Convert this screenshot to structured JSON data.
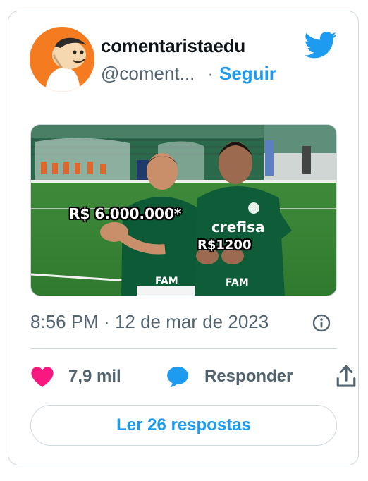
{
  "tweet": {
    "display_name": "comentaristaedu",
    "handle": "@coment...",
    "separator": "·",
    "follow_label": "Seguir",
    "timestamp": "8:56 PM · 12 de mar de 2023",
    "media": {
      "caption_top": "R$ 6.000.000*",
      "caption_bottom": "R$1200"
    },
    "likes_count": "7,9 mil",
    "reply_label": "Responder",
    "read_replies_label": "Ler 26 respostas"
  },
  "icons": {
    "brand_logo": "twitter-bird-icon",
    "info": "info-circle-icon",
    "like": "heart-icon",
    "reply": "speech-bubble-icon",
    "share": "share-upload-icon"
  },
  "colors": {
    "accent": "#1d9bf0",
    "like": "#f91880",
    "muted_text": "#536471",
    "border": "#cfd9de",
    "avatar_bg": "#f47b20"
  }
}
